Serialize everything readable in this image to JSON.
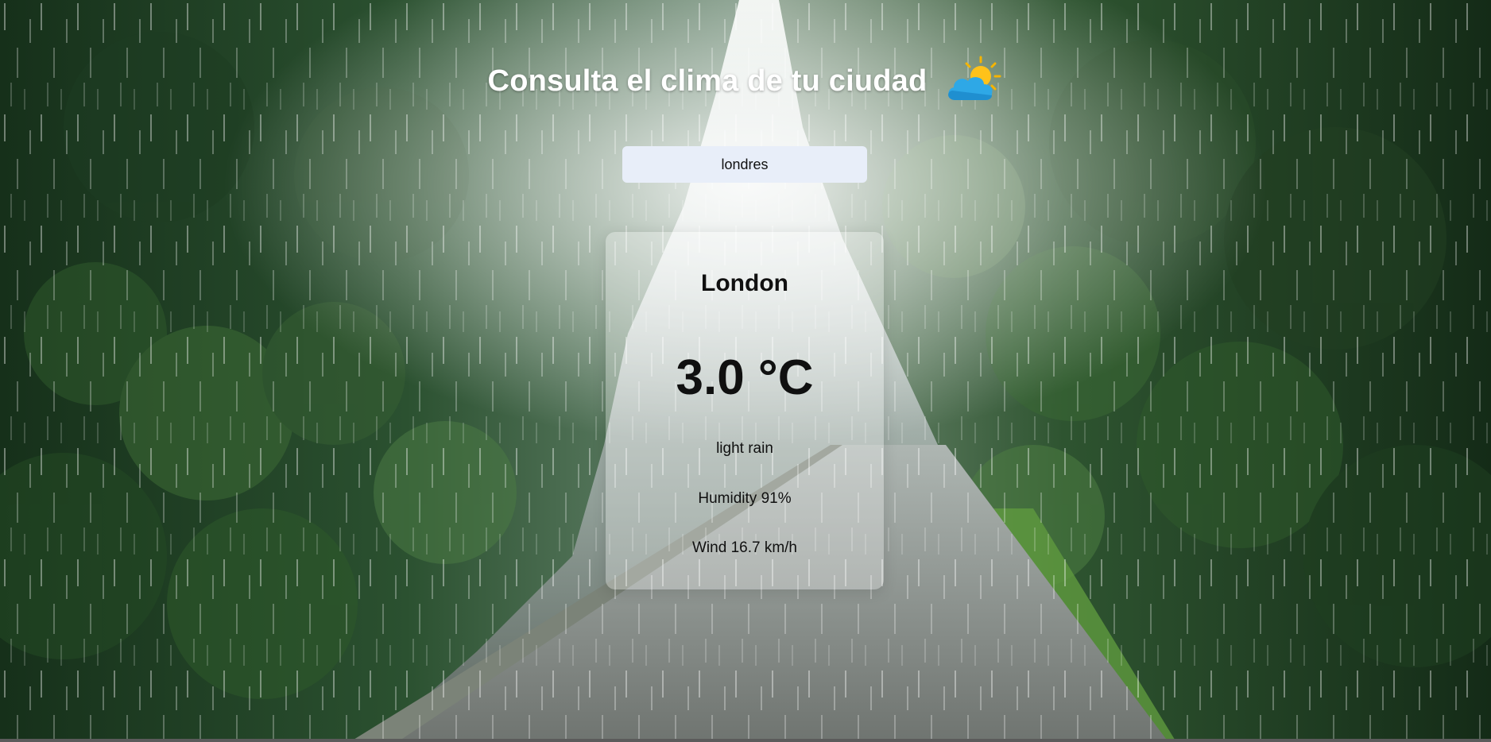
{
  "header": {
    "title": "Consulta el clima de tu ciudad",
    "icon": "sun-behind-cloud-icon"
  },
  "search": {
    "value": "londres"
  },
  "weather": {
    "city": "London",
    "temperature": "3.0 °C",
    "description": "light rain",
    "humidity": "Humidity 91%",
    "wind": "Wind 16.7 km/h"
  },
  "colors": {
    "title_text": "#ffffff",
    "input_background": "#e8eef9",
    "card_background": "rgba(255,255,255,0.30)",
    "card_text": "#101010"
  }
}
